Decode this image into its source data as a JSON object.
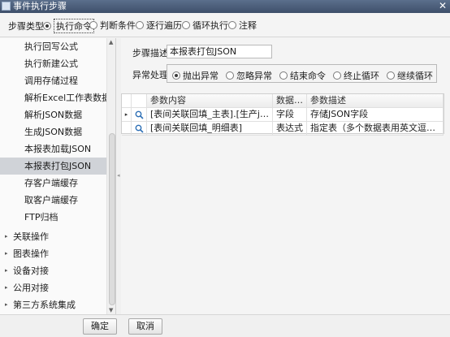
{
  "window": {
    "title": "事件执行步骤",
    "close_glyph": "✕"
  },
  "step_type": {
    "label": "步骤类型",
    "options": [
      "执行命令",
      "判断条件",
      "逐行遍历",
      "循环执行",
      "注释"
    ],
    "selected": "执行命令"
  },
  "tree": {
    "children": [
      "执行回写公式",
      "执行新建公式",
      "调用存储过程",
      "解析Excel工作表数据",
      "解析JSON数据",
      "生成JSON数据",
      "本报表加载JSON",
      "本报表打包JSON",
      "存客户端缓存",
      "取客户端缓存",
      "FTP归档"
    ],
    "selected": "本报表打包JSON",
    "groups": [
      "关联操作",
      "图表操作",
      "设备对接",
      "公用对接",
      "第三方系统集成"
    ],
    "collapsed_glyph": "▸"
  },
  "form": {
    "desc_label": "步骤描述",
    "desc_value": "本报表打包JSON",
    "error_label": "异常处理",
    "error_options": [
      "抛出异常",
      "忽略异常",
      "结束命令",
      "终止循环",
      "继续循环"
    ],
    "error_selected": "抛出异常"
  },
  "grid": {
    "columns": [
      "参数内容",
      "数据类型",
      "参数描述"
    ],
    "rows": [
      {
        "content": "[表间关联回填_主表].[生产json]",
        "type": "字段",
        "desc": "存储JSON字段",
        "current": true
      },
      {
        "content": "[表间关联回填_明细表]",
        "type": "表达式",
        "desc": "指定表（多个数据表用英文逗号间隔）为...",
        "current": false
      }
    ],
    "row_indicator_glyph": "▸"
  },
  "buttons": {
    "ok": "确定",
    "cancel": "取消"
  },
  "colors": {
    "titlebar": "#4a5c78",
    "selected_row": "#d0d3d8",
    "magnifier": "#2d6fb5"
  }
}
